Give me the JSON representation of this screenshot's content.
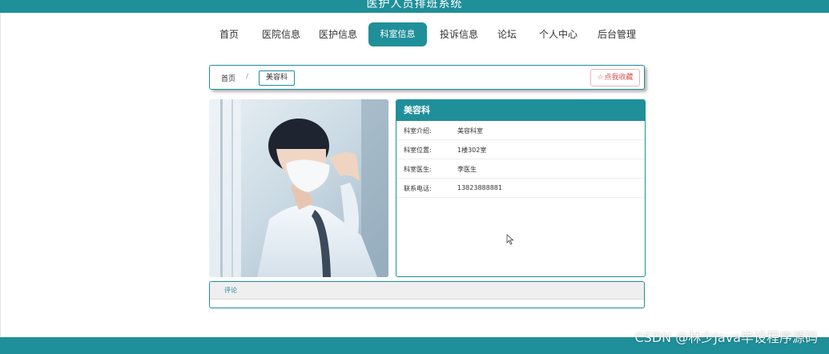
{
  "header": {
    "title": "医护人员排班系统"
  },
  "nav": {
    "items": [
      {
        "label": "首页"
      },
      {
        "label": "医院信息"
      },
      {
        "label": "医护信息"
      },
      {
        "label": "科室信息",
        "active": true
      },
      {
        "label": "投诉信息"
      },
      {
        "label": "论坛"
      },
      {
        "label": "个人中心"
      },
      {
        "label": "后台管理"
      }
    ]
  },
  "breadcrumb": {
    "home": "首页",
    "separator": "/",
    "current": "美容科"
  },
  "favorite": {
    "icon": "star-icon",
    "label": "点我收藏"
  },
  "detail": {
    "title": "美容科",
    "rows": [
      {
        "label": "科室介绍:",
        "value": "美容科室"
      },
      {
        "label": "科室位置:",
        "value": "1楼302室"
      },
      {
        "label": "科室医生:",
        "value": "李医生"
      },
      {
        "label": "联系电话:",
        "value": "13823888881"
      }
    ]
  },
  "comments": {
    "tab_label": "评论"
  },
  "watermark": "CSDN @林少Java毕设程序源码",
  "colors": {
    "accent": "#1f8f9a",
    "favorite": "#d9534f"
  }
}
